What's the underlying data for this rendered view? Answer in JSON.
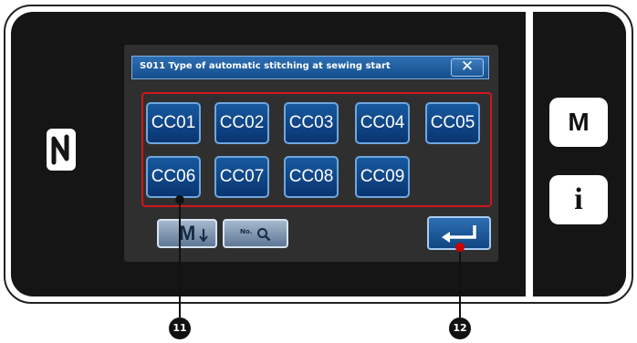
{
  "dialog": {
    "title": "S011 Type of automatic stitching at sewing start",
    "close_label": "✕"
  },
  "options": [
    "CC01",
    "CC02",
    "CC03",
    "CC04",
    "CC05",
    "CC06",
    "CC07",
    "CC08",
    "CC09"
  ],
  "toolbar": {
    "m_label": "M",
    "search_label": "No.",
    "enter_icon": "enter-arrow-icon"
  },
  "side_buttons": {
    "menu_label": "M",
    "info_label": "i"
  },
  "nfc_icon": "nfc-icon",
  "callouts": {
    "options_callout": "11",
    "enter_callout": "12"
  }
}
